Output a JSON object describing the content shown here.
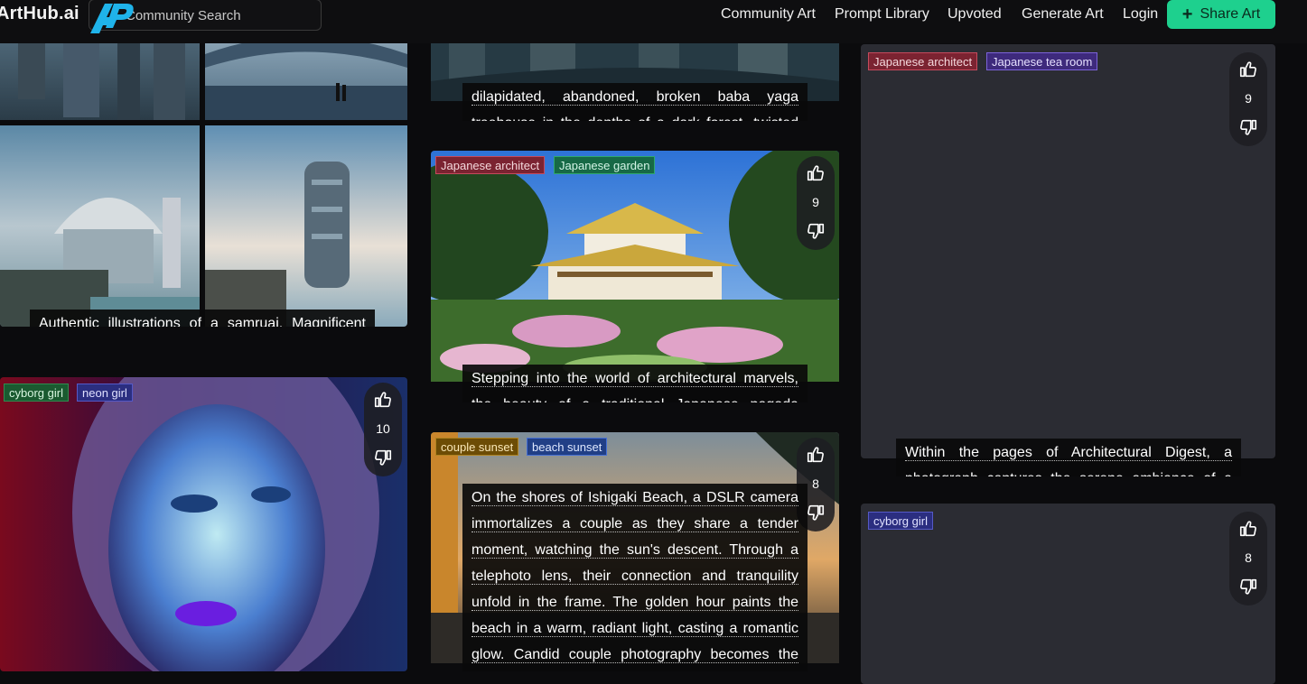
{
  "brand": {
    "name": "ArtHub.ai"
  },
  "search": {
    "placeholder": "Community Search"
  },
  "nav": {
    "items": [
      "Community Art",
      "Prompt Library",
      "Upvoted",
      "Generate Art",
      "Login"
    ],
    "share_label": "Share Art"
  },
  "colors": {
    "accent": "#1ed08e",
    "background": "#0b0b0d",
    "card_placeholder": "#2b2c33"
  },
  "cards": {
    "samurai": {
      "prompt": "Authentic illustrations of a samruai, Magnificent scenery, high quality, Shot by Leica camera"
    },
    "cyborg": {
      "tags": [
        "cyborg girl",
        "neon girl"
      ],
      "votes": "10"
    },
    "babayaga": {
      "prompt": "dilapidated, abandoned, broken baba yaga treehouse in the depths of a dark forest, twisted trees"
    },
    "pagoda": {
      "tags": [
        "Japanese architect",
        "Japanese garden"
      ],
      "votes": "9",
      "prompt": "Stepping into the world of architectural marvels, the beauty of a traditional Japanese pagoda garden unfolds"
    },
    "beach": {
      "tags": [
        "couple sunset",
        "beach sunset"
      ],
      "votes": "8",
      "prompt": "On the shores of Ishigaki Beach, a DSLR camera immortalizes a couple as they share a tender moment, watching the sun's descent. Through a telephoto lens, their connection and tranquility unfold in the frame. The golden hour paints the beach in a warm, radiant light, casting a romantic glow. Candid couple photography becomes the chosen style,"
    },
    "tearoom": {
      "tags": [
        "Japanese architect",
        "Japanese tea room"
      ],
      "votes": "9",
      "prompt": "Within the pages of Architectural Digest, a photograph captures the serene ambiance of a Japanese tea room"
    },
    "cyborg2": {
      "tags": [
        "cyborg girl"
      ],
      "votes": "8"
    }
  }
}
